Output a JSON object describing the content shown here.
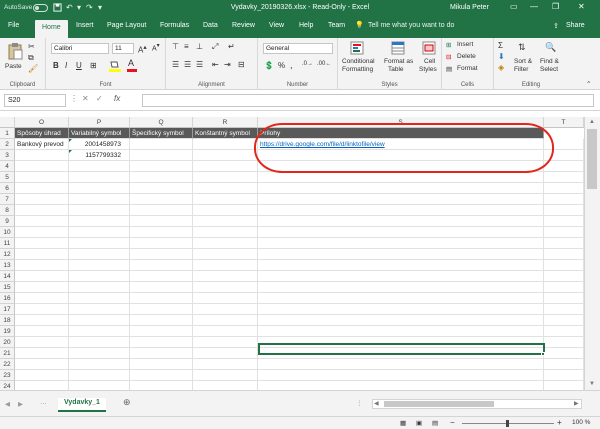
{
  "titlebar": {
    "autosave": "AutoSave",
    "autosave_state": "Off",
    "title": "Vydavky_20190326.xlsx  -  Read-Only  -  Excel",
    "user": "Mikula Peter",
    "icons": [
      "save-icon",
      "undo-icon",
      "redo-icon",
      "customize-qat-icon",
      "ribbon-display-icon",
      "minimize-icon",
      "restore-icon",
      "close-icon"
    ]
  },
  "tabs": [
    "File",
    "Home",
    "Insert",
    "Page Layout",
    "Formulas",
    "Data",
    "Review",
    "View",
    "Help",
    "Team"
  ],
  "active_tab": "Home",
  "tellme": "Tell me what you want to do",
  "share": "Share",
  "ribbon": {
    "clipboard": {
      "label": "Clipboard",
      "paste": "Paste"
    },
    "font": {
      "label": "Font",
      "font_name": "Calibri",
      "font_size": "11",
      "bold": "B",
      "italic": "I",
      "underline": "U"
    },
    "alignment": {
      "label": "Alignment"
    },
    "number": {
      "label": "Number",
      "format": "General",
      "percent": "%",
      "comma": ","
    },
    "styles": {
      "label": "Styles",
      "conditional1": "Conditional",
      "conditional2": "Formatting",
      "format_table1": "Format as",
      "format_table2": "Table",
      "cell_styles1": "Cell",
      "cell_styles2": "Styles"
    },
    "cells": {
      "label": "Cells",
      "insert": "Insert",
      "delete": "Delete",
      "format": "Format"
    },
    "editing": {
      "label": "Editing",
      "sum": "Σ",
      "sort1": "Sort &",
      "sort2": "Filter",
      "find1": "Find &",
      "find2": "Select"
    }
  },
  "formulabar": {
    "namebox": "S20",
    "fx": "fx",
    "value": ""
  },
  "grid": {
    "columns": [
      "O",
      "P",
      "Q",
      "R",
      "S",
      "T"
    ],
    "rows": [
      "1",
      "2",
      "3",
      "4",
      "5",
      "6",
      "7",
      "8",
      "9",
      "10",
      "11",
      "12",
      "13",
      "14",
      "15",
      "16",
      "17",
      "18",
      "19",
      "20",
      "21",
      "22",
      "23",
      "24"
    ],
    "header_row": [
      "Spôsoby úhrad",
      "Variabilný symbol",
      "Špecifický symbol",
      "Konštantný symbol",
      "Prílohy"
    ],
    "r2": {
      "O": "Bankový prevod",
      "P": "2001458973",
      "S": "https://drive.google.com/file/d/linktofile/view"
    },
    "r3": {
      "P": "1157799332"
    },
    "selected_cell": "S20"
  },
  "sheets": [
    "Vydavky_1"
  ],
  "status": {
    "zoom": "100 %",
    "minus": "−",
    "plus": "+"
  },
  "colors": {
    "accent": "#217346",
    "header_fill": "#595959",
    "annotation": "#e2261c",
    "link": "#0563c1"
  }
}
